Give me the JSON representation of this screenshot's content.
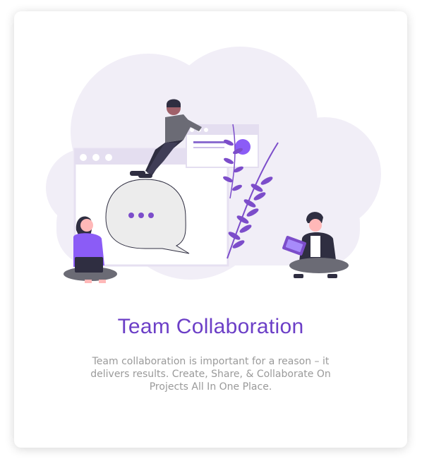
{
  "card": {
    "title": "Team Collaboration",
    "description": "Team collaboration is important for a reason – it delivers results. Create, Share, & Collaborate On Projects All In One Place."
  },
  "illustration": {
    "icons": [
      "cloud-backdrop",
      "browser-window",
      "speech-bubble",
      "ellipsis-dots",
      "leaf-branch",
      "person-sitting-top",
      "person-with-laptop",
      "person-with-tablet"
    ]
  },
  "colors": {
    "accent": "#6c3fc7",
    "cloud": "#f0edf7",
    "window": "#e4def0",
    "dark": "#2f2e41",
    "grey": "#6b6b75"
  }
}
